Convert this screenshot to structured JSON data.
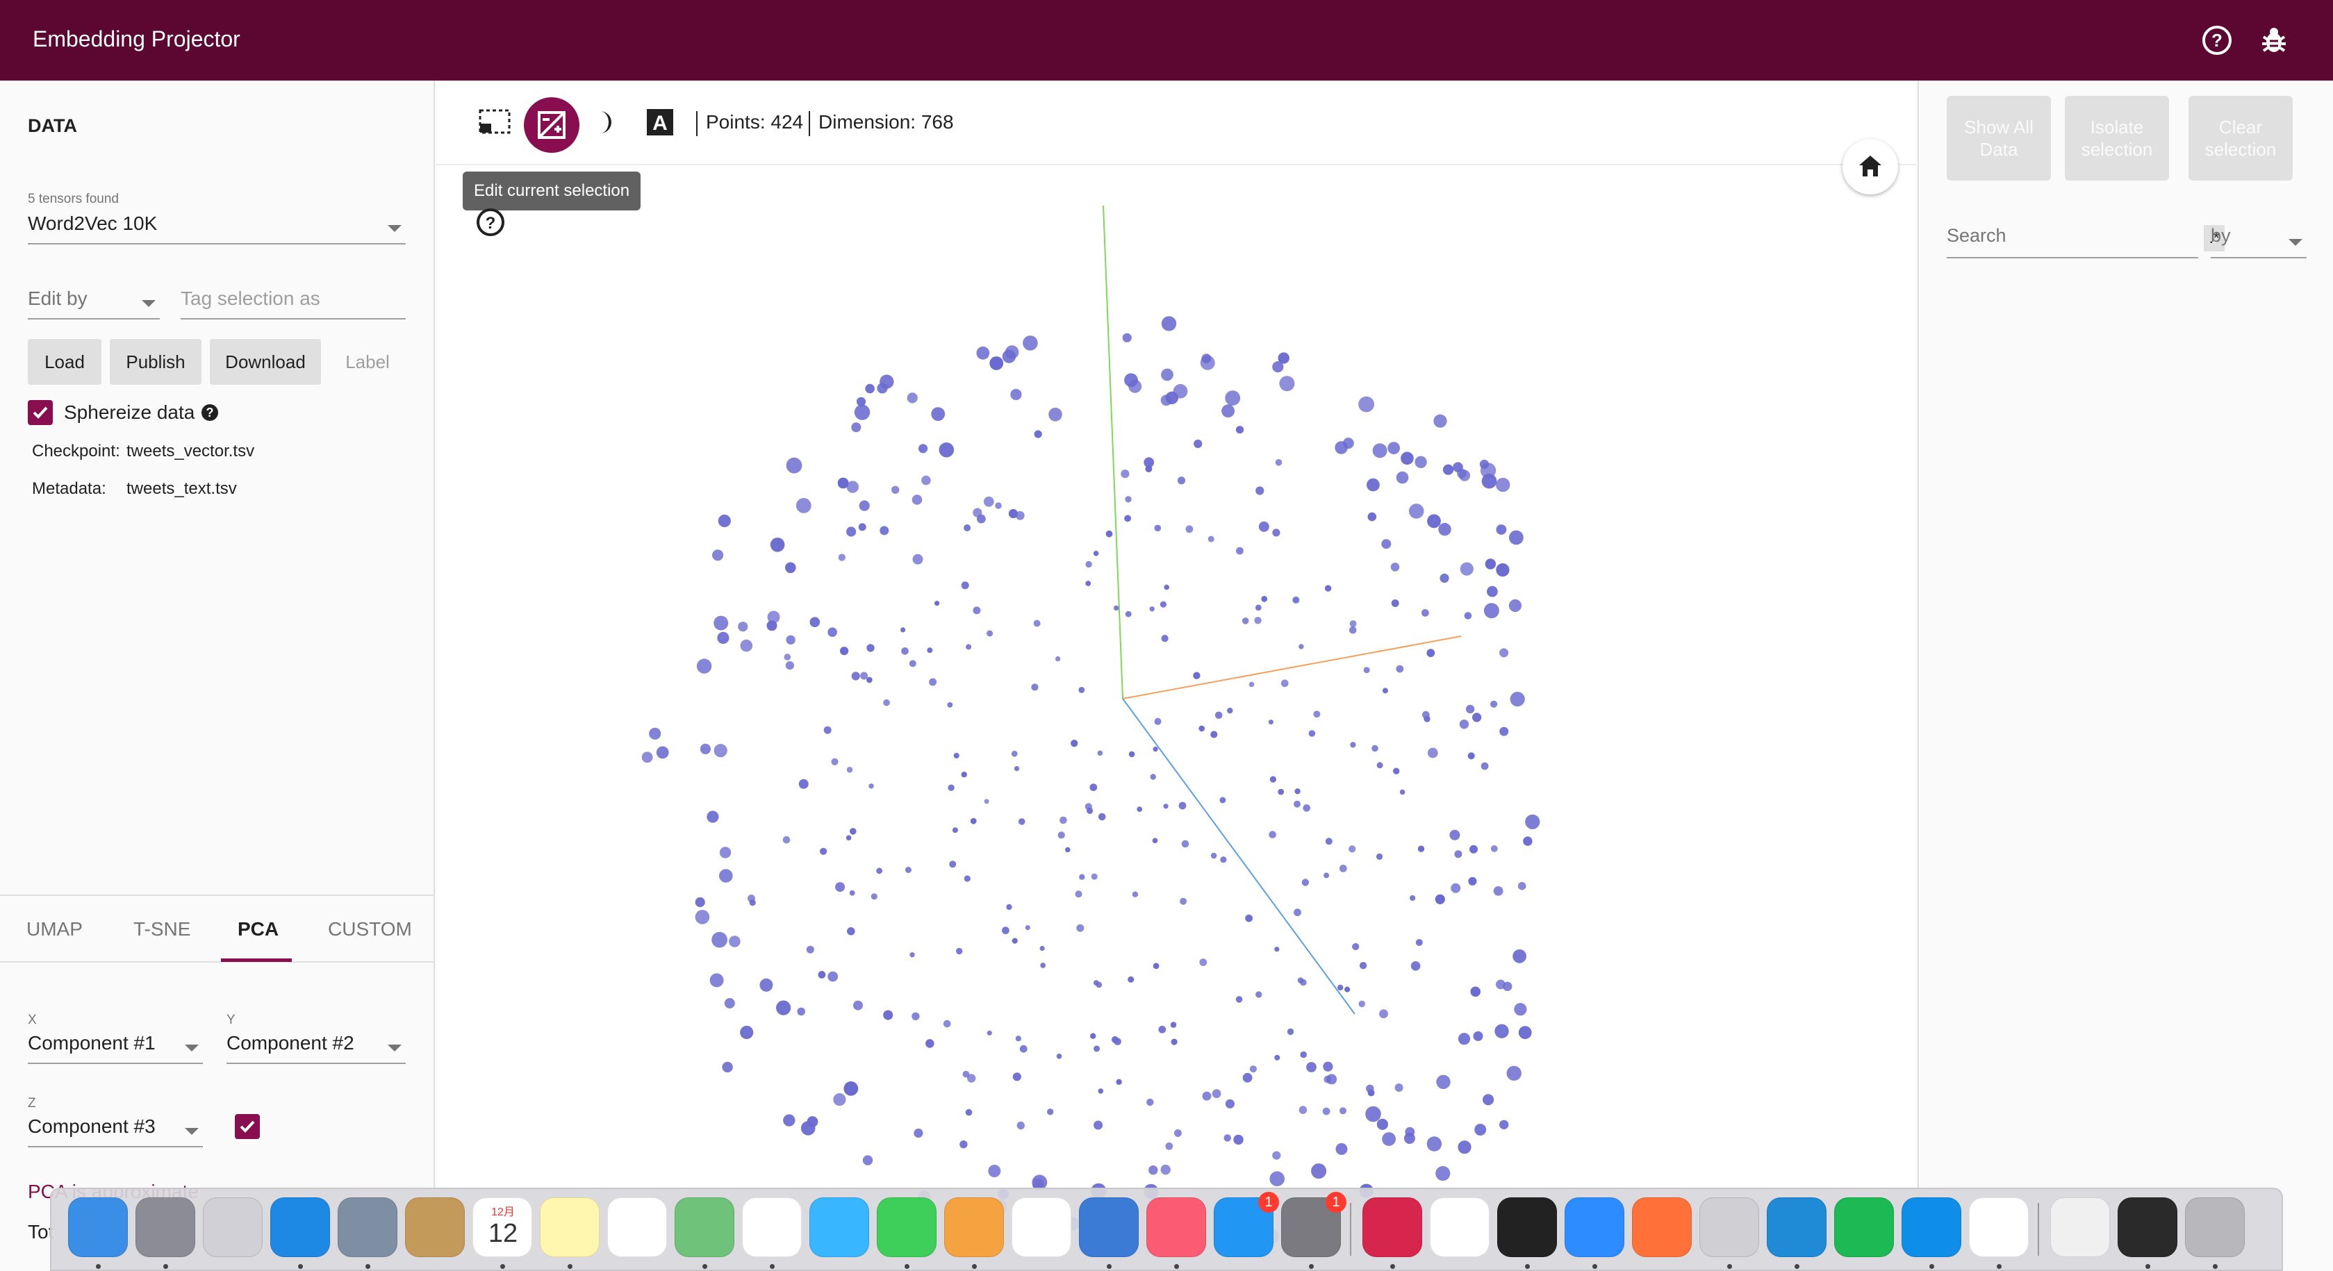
{
  "app": {
    "title": "Embedding Projector"
  },
  "topbar": {
    "icons": [
      "help-icon",
      "bug-icon"
    ]
  },
  "data_panel": {
    "title": "DATA",
    "tensors_found": "5 tensors found",
    "tensor_selected": "Word2Vec 10K",
    "edit_by": "Edit by",
    "tag_placeholder": "Tag selection as",
    "buttons": {
      "load": "Load",
      "publish": "Publish",
      "download": "Download",
      "label": "Label"
    },
    "sphereize": {
      "label": "Sphereize data",
      "checked": true
    },
    "checkpoint": {
      "key": "Checkpoint:",
      "value": "tweets_vector.tsv"
    },
    "metadata": {
      "key": "Metadata:",
      "value": "tweets_text.tsv"
    }
  },
  "projection_tabs": {
    "tabs": [
      "UMAP",
      "T-SNE",
      "PCA",
      "CUSTOM"
    ],
    "active": "PCA"
  },
  "pca": {
    "x_label": "X",
    "x_value": "Component #1",
    "y_label": "Y",
    "y_value": "Component #2",
    "z_label": "Z",
    "z_value": "Component #3",
    "z_enabled": true,
    "note_partial": "PCA is approximate",
    "total_partial": "Tot"
  },
  "toolbar": {
    "tooltip": "Edit current selection",
    "points_label": "Points: 424",
    "dimension_label": "Dimension: 768"
  },
  "right_panel": {
    "show_all": "Show All Data",
    "isolate": "Isolate selection",
    "clear": "Clear selection",
    "search_placeholder": "Search",
    "regex": ".*",
    "by": "by"
  },
  "dock": {
    "apps": [
      "Finder",
      "Launchpad",
      "Help",
      "Safari",
      "Preview",
      "Contacts",
      "Calendar",
      "Notes",
      "Reminders",
      "Maps",
      "Photos",
      "Messages",
      "FaceTime",
      "Pages",
      "Numbers",
      "Keynote",
      "Music",
      "App Store",
      "System Preferences",
      "Scrobbles",
      "Chrome",
      "Terminal",
      "Zoom",
      "Firefox",
      "Keychain",
      "VS Code",
      "Spotify",
      "TeamViewer",
      "Slack",
      "Archive Utility",
      "Display",
      "Trash"
    ],
    "calendar_day": "12",
    "calendar_month": "12月",
    "badge": "1"
  },
  "colors": {
    "brand": "#5c0632",
    "accent": "#880e4f",
    "point": "#6a6ad0"
  }
}
